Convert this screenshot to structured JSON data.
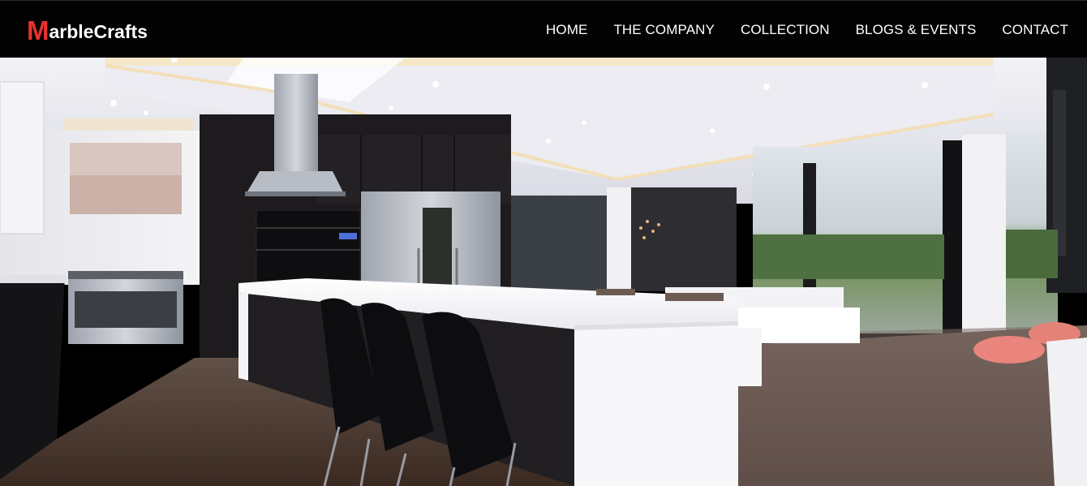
{
  "header": {
    "logo_first": "M",
    "logo_rest": "arbleCrafts"
  },
  "nav": {
    "items": [
      {
        "label": "HOME"
      },
      {
        "label": "THE COMPANY"
      },
      {
        "label": "COLLECTION"
      },
      {
        "label": "BLOGS & EVENTS"
      },
      {
        "label": "CONTACT"
      }
    ]
  },
  "colors": {
    "navbar_bg": "#030303",
    "logo_accent": "#e8322d",
    "nav_text": "#ffffff"
  }
}
